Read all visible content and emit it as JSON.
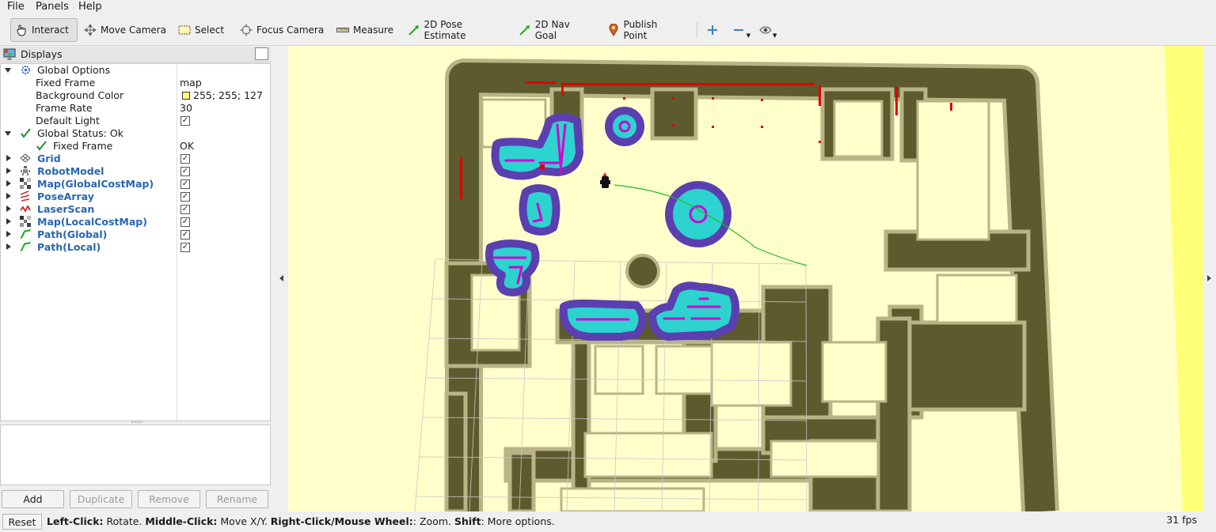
{
  "menu": {
    "file": "File",
    "panels": "Panels",
    "help": "Help"
  },
  "toolbar": {
    "interact": "Interact",
    "move_camera": "Move Camera",
    "select": "Select",
    "focus_camera": "Focus Camera",
    "measure": "Measure",
    "pose_estimate": "2D Pose Estimate",
    "nav_goal": "2D Nav Goal",
    "publish_point": "Publish Point"
  },
  "displays": {
    "title": "Displays",
    "global_options": "Global Options",
    "fixed_frame_label": "Fixed Frame",
    "fixed_frame_value": "map",
    "background_color_label": "Background Color",
    "background_color_value": "255; 255; 127",
    "background_color_swatch": "#ffff7f",
    "frame_rate_label": "Frame Rate",
    "frame_rate_value": "30",
    "default_light_label": "Default Light",
    "global_status": "Global Status: Ok",
    "status_fixed_frame_label": "Fixed Frame",
    "status_fixed_frame_value": "OK",
    "items": [
      {
        "label": "Grid",
        "checked": true
      },
      {
        "label": "RobotModel",
        "checked": true
      },
      {
        "label": "Map(GlobalCostMap)",
        "checked": true
      },
      {
        "label": "PoseArray",
        "checked": true
      },
      {
        "label": "LaserScan",
        "checked": true
      },
      {
        "label": "Map(LocalCostMap)",
        "checked": true
      },
      {
        "label": "Path(Global)",
        "checked": true
      },
      {
        "label": "Path(Local)",
        "checked": true
      }
    ]
  },
  "buttons": {
    "add": "Add",
    "duplicate": "Duplicate",
    "remove": "Remove",
    "rename": "Rename",
    "reset": "Reset"
  },
  "status": {
    "left_click": "Left-Click:",
    "left_click_action": " Rotate. ",
    "middle_click": "Middle-Click:",
    "middle_click_action": " Move X/Y. ",
    "right_click": "Right-Click/Mouse Wheel:",
    "right_click_action": ": Zoom. ",
    "shift": "Shift",
    "shift_action": ": More options.",
    "fps": "31 fps"
  },
  "colors": {
    "wall": "#5d5a2e",
    "background": "#ffffcc",
    "inflation_outer": "#5b3fb0",
    "inflation_inner": "#2dd3cf",
    "obstacle": "#d400d4",
    "laser": "#e00000",
    "path": "#22bb22"
  }
}
